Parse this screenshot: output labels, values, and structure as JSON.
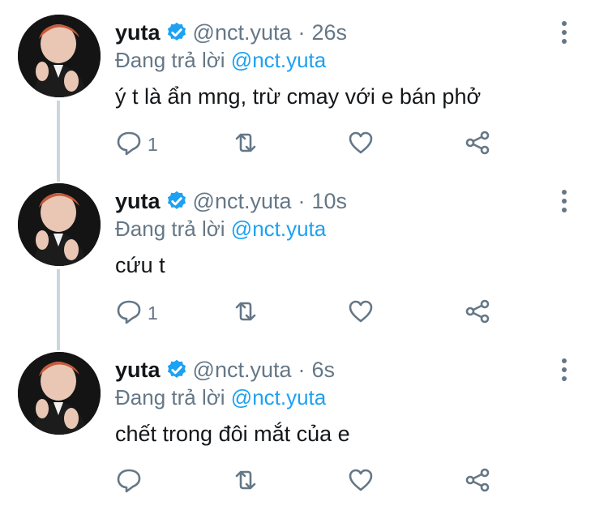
{
  "tweets": [
    {
      "name": "yuta",
      "handle": "@nct.yuta",
      "separator": "·",
      "time": "26s",
      "replying_prefix": "Đang trả lời",
      "replying_to": "@nct.yuta",
      "text": "ý t là ẩn mng, trừ cmay với e bán phở",
      "reply_count": "1"
    },
    {
      "name": "yuta",
      "handle": "@nct.yuta",
      "separator": "·",
      "time": "10s",
      "replying_prefix": "Đang trả lời",
      "replying_to": "@nct.yuta",
      "text": "cứu t",
      "reply_count": "1"
    },
    {
      "name": "yuta",
      "handle": "@nct.yuta",
      "separator": "·",
      "time": "6s",
      "replying_prefix": "Đang trả lời",
      "replying_to": "@nct.yuta",
      "text": "chết trong đôi mắt của e",
      "reply_count": ""
    }
  ],
  "colors": {
    "accent": "#1da1f2",
    "secondary_text": "#657786",
    "primary_text": "#14171a",
    "thread_line": "#ccd6dd"
  },
  "icons": [
    "verified-badge-icon",
    "reply-icon",
    "retweet-icon",
    "like-icon",
    "share-icon",
    "more-icon"
  ]
}
